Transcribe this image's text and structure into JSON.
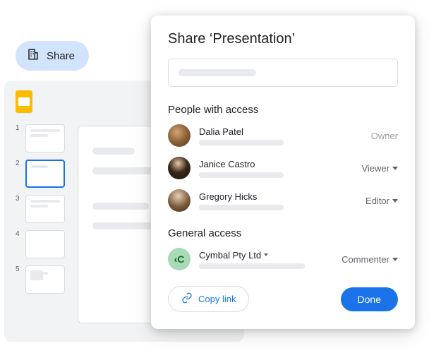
{
  "share_chip_label": "Share",
  "slides": {
    "thumbnails": [
      1,
      2,
      3,
      4,
      5
    ],
    "active_index": 2
  },
  "modal": {
    "title": "Share ‘Presentation’",
    "people_section": "People with access",
    "general_section": "General access",
    "copy_link_label": "Copy link",
    "done_label": "Done",
    "people": [
      {
        "name": "Dalia Patel",
        "role": "Owner",
        "role_type": "owner"
      },
      {
        "name": "Janice Castro",
        "role": "Viewer",
        "role_type": "dropdown"
      },
      {
        "name": "Gregory Hicks",
        "role": "Editor",
        "role_type": "dropdown"
      }
    ],
    "org": {
      "name": "Cymbal Pty Ltd",
      "badge": "‹C",
      "role": "Commenter"
    }
  }
}
